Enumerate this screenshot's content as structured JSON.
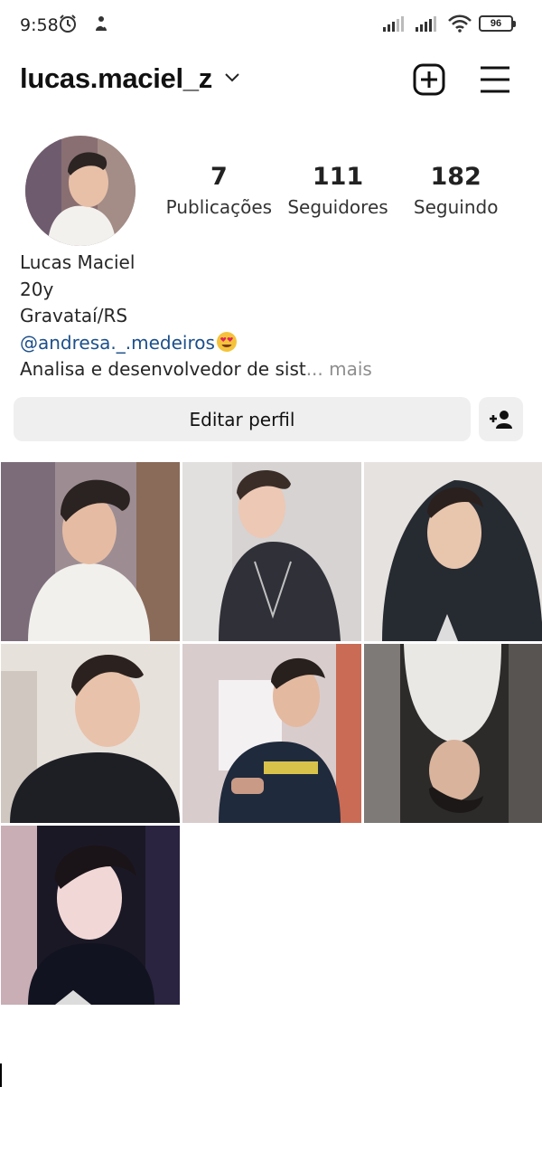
{
  "status_bar": {
    "time": "9:58",
    "battery": "96"
  },
  "header": {
    "username": "lucas.maciel_z",
    "icons": [
      "chevron-down-icon",
      "new-post-icon",
      "menu-icon"
    ]
  },
  "profile": {
    "stats": [
      {
        "value": "7",
        "label": "Publicações"
      },
      {
        "value": "111",
        "label": "Seguidores"
      },
      {
        "value": "182",
        "label": "Seguindo"
      }
    ],
    "bio": {
      "name": "Lucas Maciel",
      "line1": "20y",
      "line2": "Gravataí/RS",
      "mention": "@andresa._.medeiros",
      "description": "Analisa e desenvolvedor de sist",
      "more": "... mais"
    }
  },
  "actions": {
    "edit_profile": "Editar perfil"
  },
  "posts": {
    "count": 7
  },
  "colors": {
    "accent_link": "#1c4f8a",
    "button_bg": "#efefef"
  }
}
